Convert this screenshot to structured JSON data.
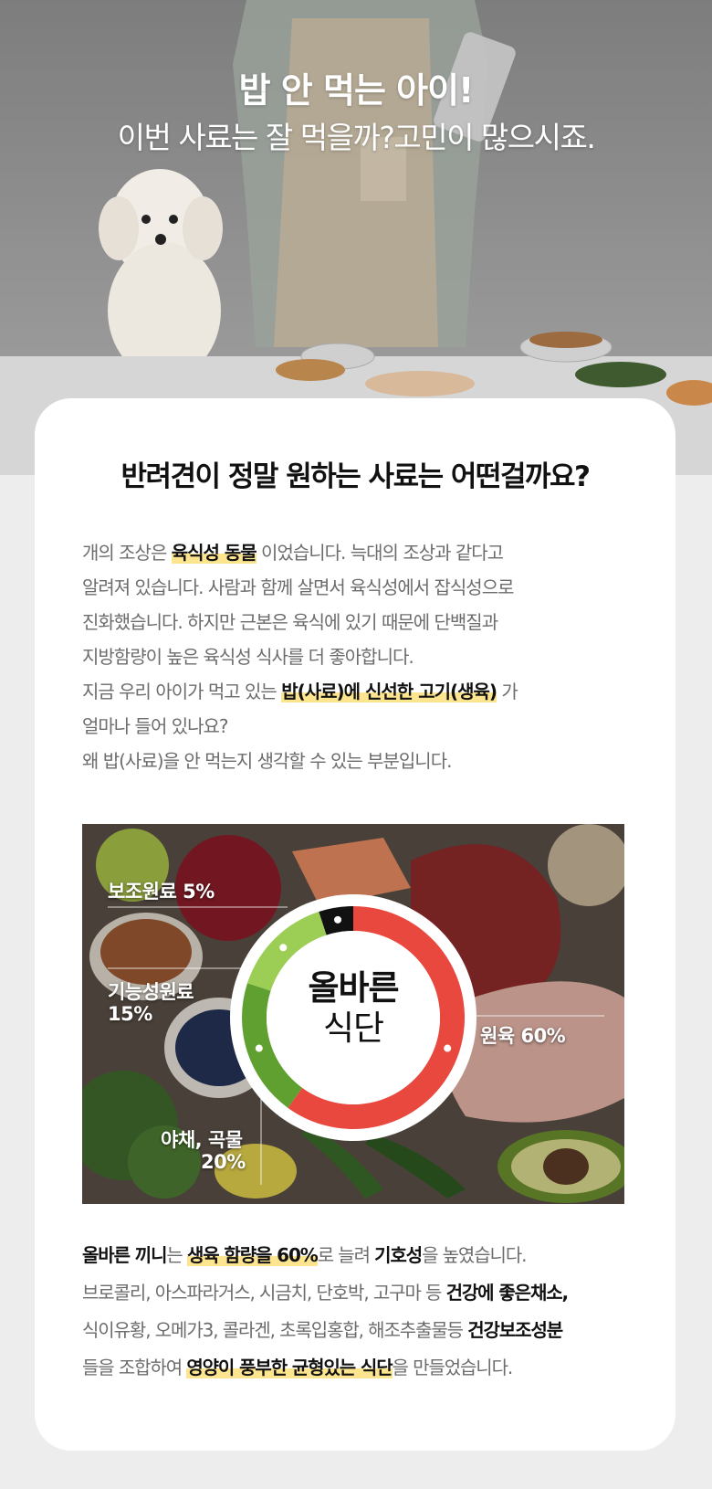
{
  "hero": {
    "title": "밥 안 먹는 아이!",
    "subtitle": "이번 사료는 잘 먹을까?고민이 많으시죠."
  },
  "card": {
    "title": "반려견이 정말 원하는 사료는 어떤걸까요?",
    "intro": {
      "l1a": "개의 조상은 ",
      "l1b": "육식성 동물",
      "l1c": " 이었습니다. 늑대의 조상과 같다고",
      "l2": "알려져 있습니다. 사람과 함께 살면서 육식성에서 잡식성으로",
      "l3": "진화했습니다. 하지만 근본은 육식에 있기 때문에 단백질과",
      "l4": "지방함량이 높은 육식성 식사를 더 좋아합니다.",
      "l5a": "지금 우리 아이가 먹고 있는 ",
      "l5b": "밥(사료)에 신선한 고기(생육)",
      "l5c": " 가",
      "l6": "얼마나 들어 있나요?",
      "l7": "왜 밥(사료)을 안 먹는지 생각할 수 있는 부분입니다."
    }
  },
  "diet_chart": {
    "center_line1": "올바른",
    "center_line2": "식단",
    "labels": {
      "sub": "보조원료 5%",
      "functional_a": "기능성원료",
      "functional_b": "15%",
      "veg_a": "야채, 곡물",
      "veg_b": "20%",
      "meat": "원육 60%"
    }
  },
  "chart_data": {
    "type": "pie",
    "categories": [
      "원육",
      "야채, 곡물",
      "기능성원료",
      "보조원료"
    ],
    "values": [
      60,
      20,
      15,
      5
    ],
    "colors": [
      "#e8483e",
      "#5fa030",
      "#9ccd55",
      "#111111"
    ],
    "title": "올바른 식단"
  },
  "outro": {
    "l1a": "올바른 끼니",
    "l1b": "는 ",
    "l1c": "생육 함량을 60%",
    "l1d": "로 늘려 ",
    "l1e": "기호성",
    "l1f": "을 높였습니다.",
    "l2a": "브로콜리, 아스파라거스, 시금치, 단호박, 고구마 등 ",
    "l2b": "건강에 좋은채소,",
    "l3a": "식이유황, 오메가3, 콜라겐, 초록입홍합, 해조추출물등 ",
    "l3b": "건강보조성분",
    "l4a": "들을 조합하여 ",
    "l4b": "영양이 풍부한 균형있는 식단",
    "l4c": "을 만들었습니다."
  }
}
